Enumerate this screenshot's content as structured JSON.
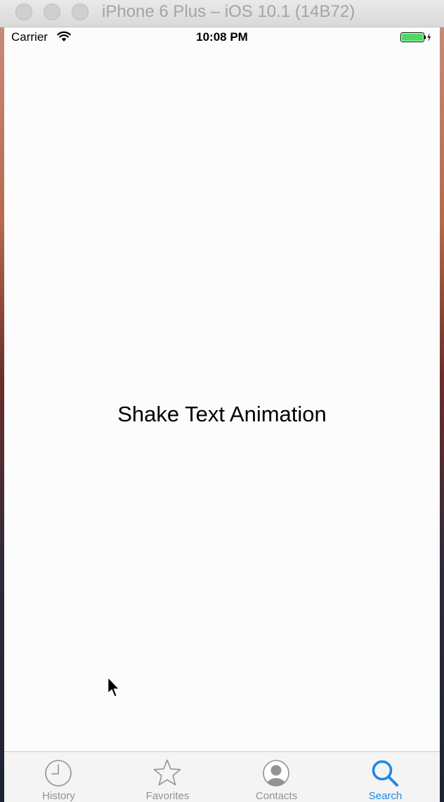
{
  "window": {
    "title": "iPhone 6 Plus – iOS 10.1 (14B72)"
  },
  "status_bar": {
    "carrier": "Carrier",
    "time": "10:08 PM",
    "wifi_icon": "wifi-icon",
    "battery_icon": "battery-charging-icon",
    "battery_color": "#4cd964"
  },
  "main": {
    "label": "Shake Text Animation"
  },
  "tab_bar": {
    "accent_color": "#1e88e5",
    "inactive_color": "#929292",
    "tabs": [
      {
        "label": "History",
        "icon": "clock-icon",
        "active": false
      },
      {
        "label": "Favorites",
        "icon": "star-icon",
        "active": false
      },
      {
        "label": "Contacts",
        "icon": "contact-icon",
        "active": false
      },
      {
        "label": "Search",
        "icon": "search-icon",
        "active": true
      }
    ]
  }
}
